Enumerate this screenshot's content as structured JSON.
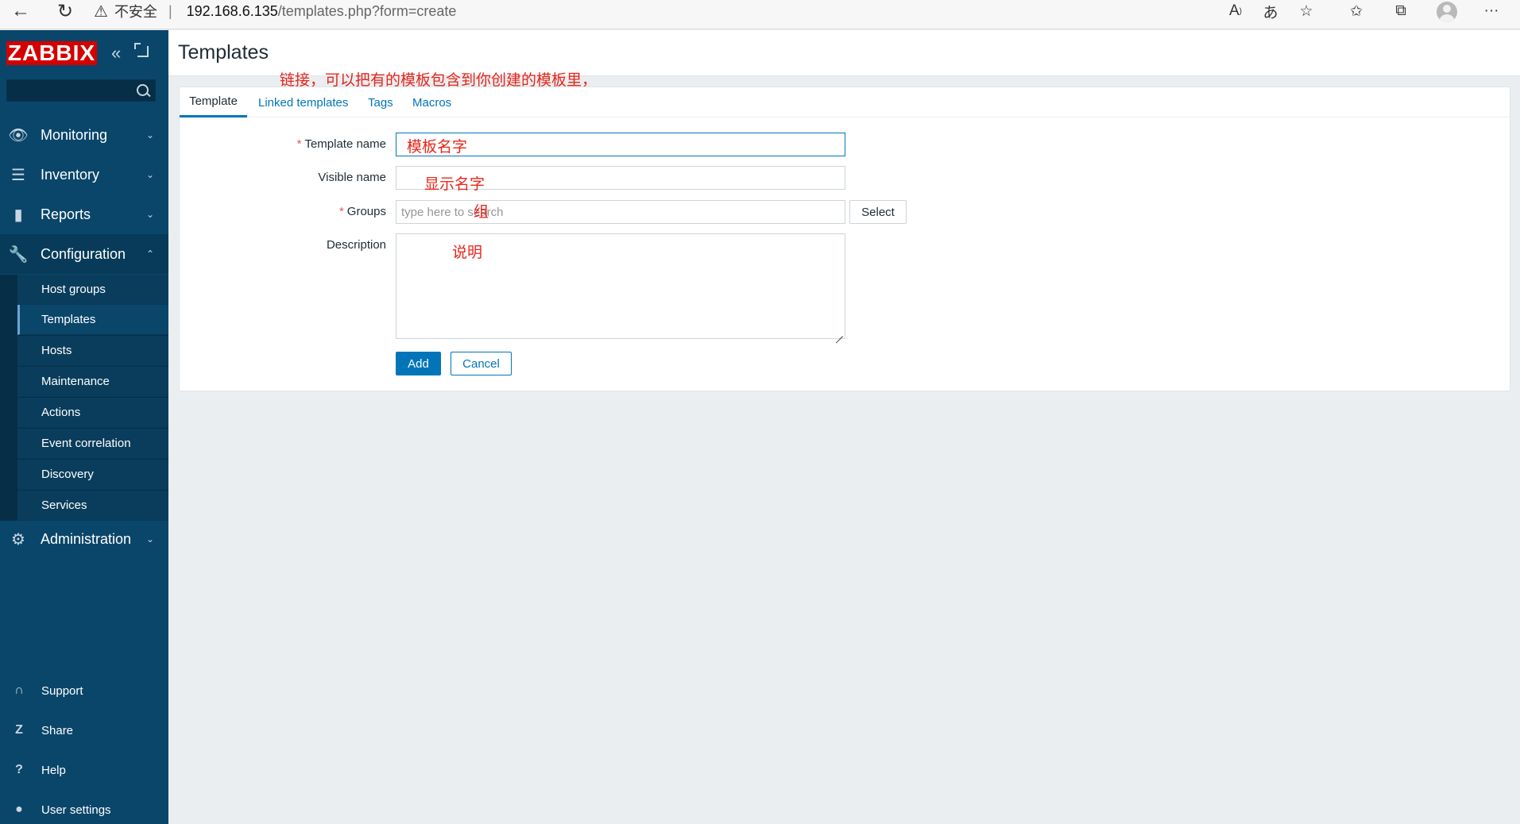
{
  "browser": {
    "security_label": "不安全",
    "url_host": "192.168.6.135",
    "url_path": "/templates.php?form=create"
  },
  "sidebar": {
    "logo": "ZABBIX",
    "search_value": "",
    "menu": [
      {
        "label": "Monitoring",
        "icon": "eye-icon",
        "expanded": false
      },
      {
        "label": "Inventory",
        "icon": "list-icon",
        "expanded": false
      },
      {
        "label": "Reports",
        "icon": "bar-chart-icon",
        "expanded": false
      },
      {
        "label": "Configuration",
        "icon": "wrench-icon",
        "expanded": true
      },
      {
        "label": "Administration",
        "icon": "gear-icon",
        "expanded": false
      }
    ],
    "config_items": [
      "Host groups",
      "Templates",
      "Hosts",
      "Maintenance",
      "Actions",
      "Event correlation",
      "Discovery",
      "Services"
    ],
    "active_config_item": "Templates",
    "footer": [
      {
        "label": "Support",
        "icon": "headset-icon"
      },
      {
        "label": "Share",
        "icon": "share-z-icon"
      },
      {
        "label": "Help",
        "icon": "help-icon"
      },
      {
        "label": "User settings",
        "icon": "user-icon"
      }
    ]
  },
  "page": {
    "title": "Templates",
    "tabs": [
      "Template",
      "Linked templates",
      "Tags",
      "Macros"
    ],
    "active_tab": "Template",
    "form": {
      "template_name_label": "Template name",
      "template_name_value": "",
      "visible_name_label": "Visible name",
      "visible_name_value": "",
      "groups_label": "Groups",
      "groups_placeholder": "type here to search",
      "select_button": "Select",
      "description_label": "Description",
      "description_value": "",
      "add_button": "Add",
      "cancel_button": "Cancel",
      "required_mark": "*"
    }
  },
  "annotations": {
    "linked_templates_note": "链接，可以把有的模板包含到你创建的模板里，",
    "template_name_note": "模板名字",
    "visible_name_note": "显示名字",
    "groups_note": "组",
    "description_note": "说明",
    "color": "#e8251a"
  },
  "colors": {
    "sidebar_bg": "#0a466a",
    "accent": "#0275b8",
    "logo_bg": "#d40000",
    "required": "#e45959"
  }
}
